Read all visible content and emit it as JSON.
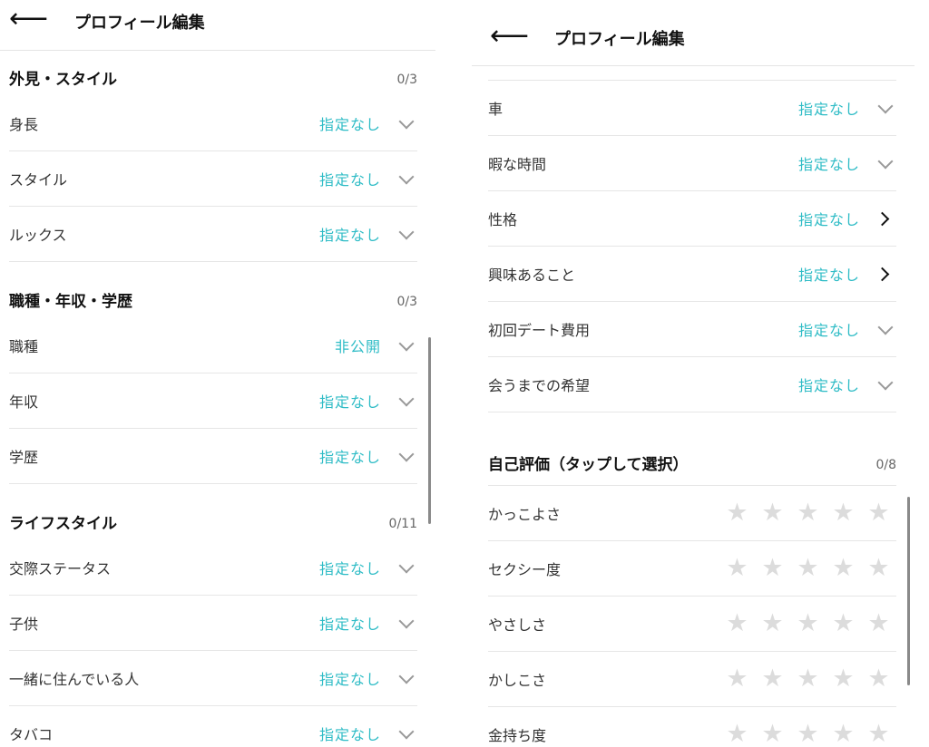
{
  "left": {
    "header": {
      "back": "⟵",
      "title": "プロフィール編集"
    },
    "sections": [
      {
        "title": "外見・スタイル",
        "count": "0/3",
        "rows": [
          {
            "label": "身長",
            "value": "指定なし"
          },
          {
            "label": "スタイル",
            "value": "指定なし"
          },
          {
            "label": "ルックス",
            "value": "指定なし"
          }
        ]
      },
      {
        "title": "職種・年収・学歴",
        "count": "0/3",
        "rows": [
          {
            "label": "職種",
            "value": "非公開"
          },
          {
            "label": "年収",
            "value": "指定なし"
          },
          {
            "label": "学歴",
            "value": "指定なし"
          }
        ]
      },
      {
        "title": "ライフスタイル",
        "count": "0/11",
        "rows": [
          {
            "label": "交際ステータス",
            "value": "指定なし"
          },
          {
            "label": "子供",
            "value": "指定なし"
          },
          {
            "label": "一緒に住んでいる人",
            "value": "指定なし"
          },
          {
            "label": "タバコ",
            "value": "指定なし"
          }
        ]
      }
    ]
  },
  "right": {
    "header": {
      "back": "⟵",
      "title": "プロフィール編集"
    },
    "rows": [
      {
        "label": "車",
        "value": "指定なし",
        "chevron": "chevron-down-icon"
      },
      {
        "label": "暇な時間",
        "value": "指定なし",
        "chevron": "chevron-down-icon"
      },
      {
        "label": "性格",
        "value": "指定なし",
        "chevron": "chevron-right-icon"
      },
      {
        "label": "興味あること",
        "value": "指定なし",
        "chevron": "chevron-right-icon"
      },
      {
        "label": "初回デート費用",
        "value": "指定なし",
        "chevron": "chevron-down-icon"
      },
      {
        "label": "会うまでの希望",
        "value": "指定なし",
        "chevron": "chevron-down-icon"
      }
    ],
    "rating_section": {
      "title": "自己評価（タップして選択）",
      "count": "0/8",
      "max_stars": 5,
      "items": [
        {
          "label": "かっこよさ",
          "rating": 0
        },
        {
          "label": "セクシー度",
          "rating": 0
        },
        {
          "label": "やさしさ",
          "rating": 0
        },
        {
          "label": "かしこさ",
          "rating": 0
        },
        {
          "label": "金持ち度",
          "rating": 0
        }
      ]
    }
  },
  "colors": {
    "accent": "#2fbcc6",
    "star_empty": "#dcdcdc",
    "divider": "#e6e6e6"
  }
}
